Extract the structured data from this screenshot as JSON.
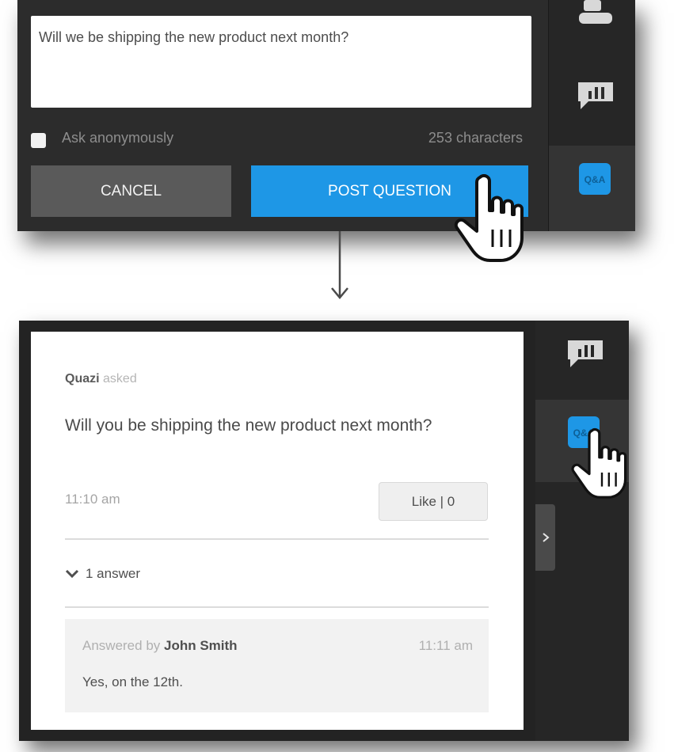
{
  "compose": {
    "question_value": "Will we be shipping the new product next month?",
    "anonymous_label": "Ask anonymously",
    "char_count": "253 characters",
    "cancel_label": "CANCEL",
    "post_label": "POST QUESTION"
  },
  "rail": {
    "icons": [
      "person-icon",
      "chat-bubble-icon",
      "qa-icon"
    ],
    "qa_icon_text": "Q&A",
    "accent_color": "#1e97e6"
  },
  "question": {
    "asker_name": "Quazi",
    "asker_verb": "asked",
    "text": "Will you be shipping the new product next month?",
    "time": "11:10 am",
    "like_label": "Like | 0",
    "answers_toggle": "1 answer"
  },
  "answer": {
    "prefix": "Answered by",
    "author": "John Smith",
    "time": "11:11 am",
    "text": "Yes, on the 12th."
  }
}
